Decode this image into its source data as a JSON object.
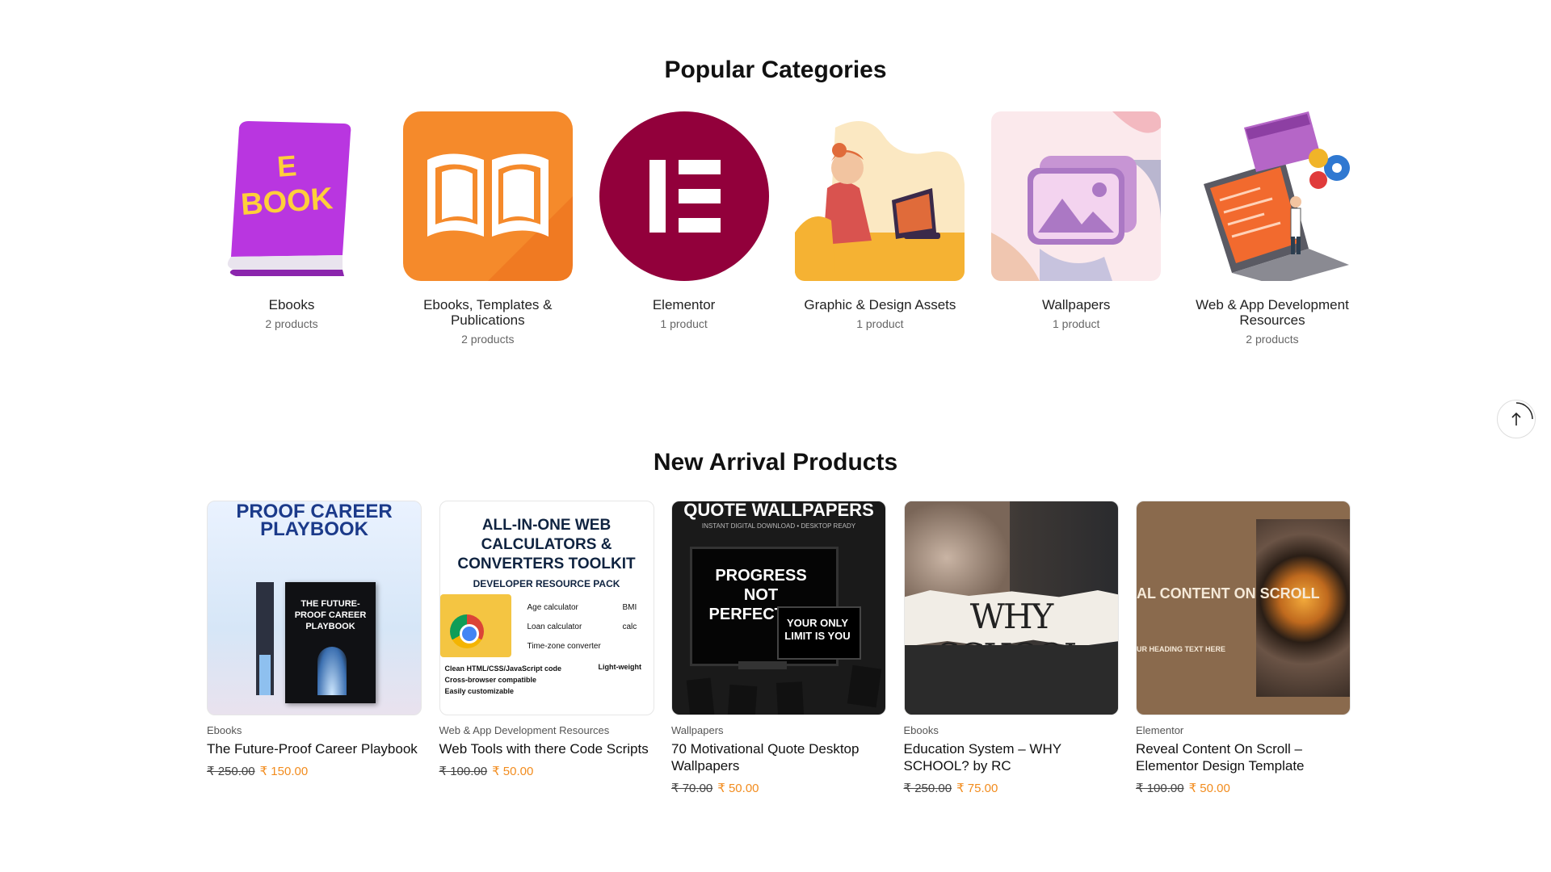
{
  "popular": {
    "title": "Popular Categories",
    "items": [
      {
        "name": "Ebooks",
        "count": "2 products",
        "icon": "ebook-icon",
        "badge_line1": "E",
        "badge_line2": "BOOK"
      },
      {
        "name": "Ebooks, Templates & Publications",
        "count": "2 products",
        "icon": "open-book-icon"
      },
      {
        "name": "Elementor",
        "count": "1 product",
        "icon": "elementor-logo-icon"
      },
      {
        "name": "Graphic & Design Assets",
        "count": "1 product",
        "icon": "designer-illustration-icon"
      },
      {
        "name": "Wallpapers",
        "count": "1 product",
        "icon": "image-placeholder-icon"
      },
      {
        "name": "Web & App Development Resources",
        "count": "2 products",
        "icon": "laptop-code-icon"
      }
    ]
  },
  "arrivals": {
    "title": "New Arrival Products",
    "items": [
      {
        "category": "Ebooks",
        "title": "The Future-Proof Career Playbook",
        "old_price": "₹ 250.00",
        "new_price": "₹ 150.00",
        "art_heading": "PROOF CAREER PLAYBOOK",
        "art_book": "THE FUTURE-PROOF CAREER PLAYBOOK"
      },
      {
        "category": "Web & App Development Resources",
        "title": "Web Tools with there Code Scripts",
        "old_price": "₹ 100.00",
        "new_price": "₹ 50.00",
        "art_heading": "ALL-IN-ONE WEB CALCULATORS & CONVERTERS TOOLKIT",
        "art_sub": "DEVELOPER RESOURCE PACK",
        "art_list": [
          "Age calculator",
          "Loan calculator",
          "Time-zone converter",
          "BMI calc"
        ],
        "art_checks": [
          "Clean HTML/CSS/JavaScript code",
          "Cross-browser compatible",
          "Easily customizable",
          "Light-weight"
        ]
      },
      {
        "category": "Wallpapers",
        "title": "70 Motivational Quote Desktop Wallpapers",
        "old_price": "₹ 70.00",
        "new_price": "₹ 50.00",
        "art_heading": "QUOTE WALLPAPERS",
        "art_sub": "INSTANT DIGITAL DOWNLOAD • DESKTOP READY",
        "art_main": "PROGRESS NOT PERFECTION",
        "art_second": "YOUR ONLY LIMIT IS YOU"
      },
      {
        "category": "Ebooks",
        "title": "Education System – WHY SCHOOL? by RC",
        "old_price": "₹ 250.00",
        "new_price": "₹ 75.00",
        "art_heading": "WHY SCHOOL"
      },
      {
        "category": "Elementor",
        "title": "Reveal Content On Scroll – Elementor Design Template",
        "old_price": "₹ 100.00",
        "new_price": "₹ 50.00",
        "art_heading": "AL CONTENT ON SCROLL",
        "art_sub": "UR HEADING TEXT HERE"
      }
    ]
  },
  "colors": {
    "accent": "#f28c1e",
    "elementor": "#92003b"
  }
}
